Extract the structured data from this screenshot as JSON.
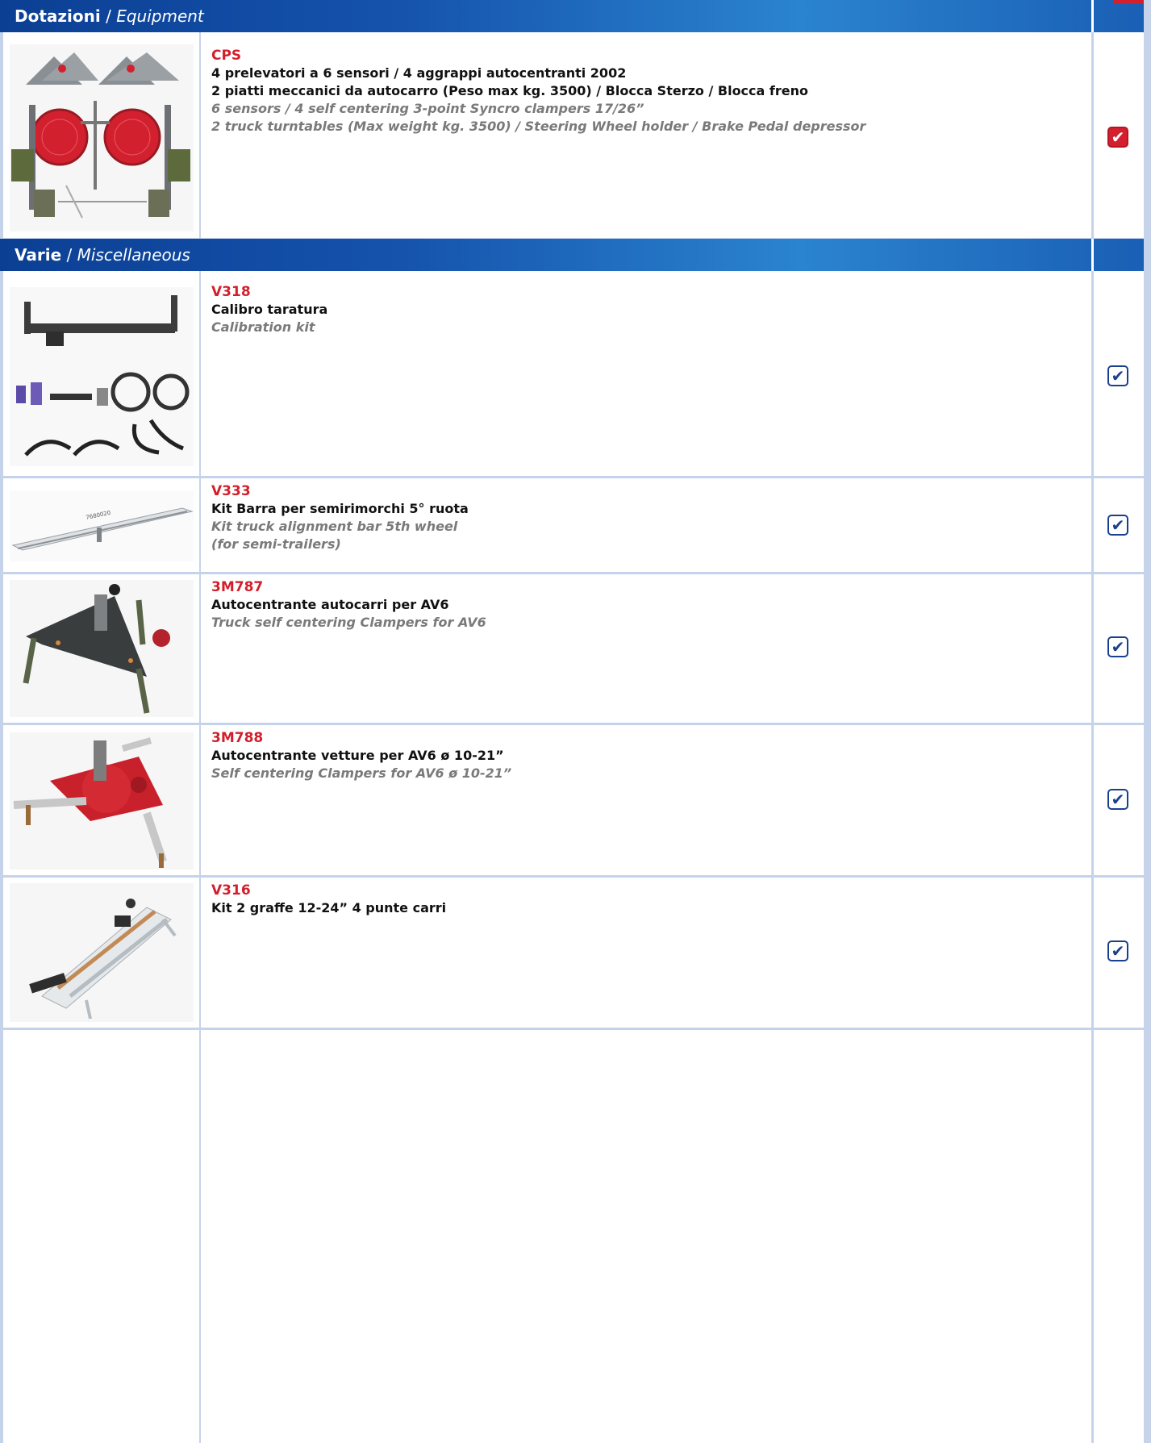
{
  "sections": {
    "equipment": {
      "title_it": "Dotazioni",
      "sep": "/",
      "title_en": "Equipment"
    },
    "misc": {
      "title_it": "Varie",
      "sep": "/",
      "title_en": "Miscellaneous"
    }
  },
  "items": [
    {
      "code": "CPS",
      "it_lines": [
        "4 prelevatori a 6 sensori / 4 aggrappi autocentranti 2002",
        "2 piatti meccanici da autocarro (Peso max kg. 3500) / Blocca Sterzo / Blocca freno"
      ],
      "en_lines": [
        "6 sensors / 4 self centering 3-point Syncro clampers 17/26”",
        "2 truck turntables (Max weight kg. 3500) / Steering Wheel holder / Brake Pedal depressor"
      ],
      "checked": true,
      "check_style": "red",
      "check_glyph": "✔"
    },
    {
      "code": "V318",
      "it_lines": [
        "Calibro taratura"
      ],
      "en_lines": [
        "Calibration kit"
      ],
      "checked": true,
      "check_style": "blue",
      "check_glyph": "✔"
    },
    {
      "code": "V333",
      "it_lines": [
        "Kit Barra per semirimorchi 5° ruota"
      ],
      "en_lines": [
        "Kit truck alignment bar 5th wheel",
        "(for semi-trailers)"
      ],
      "checked": true,
      "check_style": "blue",
      "check_glyph": "✔"
    },
    {
      "code": "3M787",
      "it_lines": [
        "Autocentrante autocarri per AV6"
      ],
      "en_lines": [
        "Truck self centering Clampers for AV6"
      ],
      "checked": true,
      "check_style": "blue",
      "check_glyph": "✔"
    },
    {
      "code": "3M788",
      "it_lines": [
        "Autocentrante vetture per AV6 ø 10-21”"
      ],
      "en_lines": [
        "Self centering Clampers for AV6 ø 10-21”"
      ],
      "checked": true,
      "check_style": "blue",
      "check_glyph": "✔"
    },
    {
      "code": "V316",
      "it_lines": [
        "Kit 2 graffe 12-24” 4 punte carri"
      ],
      "en_lines": [],
      "checked": true,
      "check_style": "blue",
      "check_glyph": "✔"
    }
  ],
  "images": {
    "v333_bar_label": "7680020"
  },
  "colors": {
    "header_dark": "#0b3f93",
    "header_light": "#2b84cf",
    "code_red": "#d21f2b",
    "grid_blue": "#c5d3ea",
    "check_blue": "#1b3f8f",
    "check_red": "#d3202f"
  }
}
